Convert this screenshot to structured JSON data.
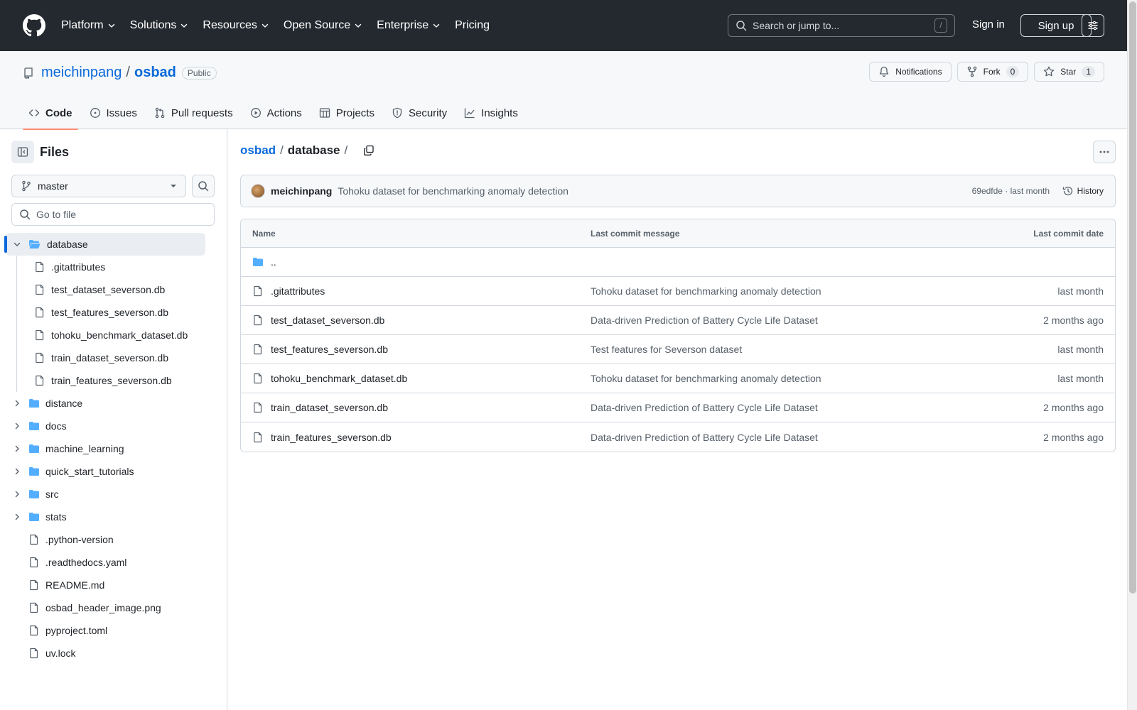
{
  "header": {
    "nav": [
      "Platform",
      "Solutions",
      "Resources",
      "Open Source",
      "Enterprise",
      "Pricing"
    ],
    "search_placeholder": "Search or jump to...",
    "search_shortcut": "/",
    "signin_label": "Sign in",
    "signup_label": "Sign up"
  },
  "repo": {
    "owner": "meichinpang",
    "separator": "/",
    "name": "osbad",
    "visibility": "Public",
    "notifications_label": "Notifications",
    "fork_label": "Fork",
    "fork_count": "0",
    "star_label": "Star",
    "star_count": "1",
    "tabs": [
      {
        "label": "Code",
        "icon": "code-icon"
      },
      {
        "label": "Issues",
        "icon": "issue-icon"
      },
      {
        "label": "Pull requests",
        "icon": "pull-request-icon"
      },
      {
        "label": "Actions",
        "icon": "play-icon"
      },
      {
        "label": "Projects",
        "icon": "table-icon"
      },
      {
        "label": "Security",
        "icon": "shield-icon"
      },
      {
        "label": "Insights",
        "icon": "graph-icon"
      }
    ]
  },
  "sidebar": {
    "title": "Files",
    "branch": "master",
    "goto_placeholder": "Go to file",
    "expanded_folder": "database",
    "expanded_children": [
      ".gitattributes",
      "test_dataset_severson.db",
      "test_features_severson.db",
      "tohoku_benchmark_dataset.db",
      "train_dataset_severson.db",
      "train_features_severson.db"
    ],
    "folders": [
      "distance",
      "docs",
      "machine_learning",
      "quick_start_tutorials",
      "src",
      "stats"
    ],
    "files": [
      ".python-version",
      ".readthedocs.yaml",
      "README.md",
      "osbad_header_image.png",
      "pyproject.toml",
      "uv.lock"
    ]
  },
  "main": {
    "breadcrumb_root": "osbad",
    "breadcrumb_current": "database",
    "breadcrumb_sep": "/",
    "commit": {
      "author": "meichinpang",
      "message": "Tohoku dataset for benchmarking anomaly detection",
      "meta": "69edfde · last month",
      "history_label": "History"
    },
    "table": {
      "headers": {
        "name": "Name",
        "message": "Last commit message",
        "date": "Last commit date"
      },
      "parent_link": "..",
      "rows": [
        {
          "name": ".gitattributes",
          "message": "Tohoku dataset for benchmarking anomaly detection",
          "date": "last month"
        },
        {
          "name": "test_dataset_severson.db",
          "message": "Data-driven Prediction of Battery Cycle Life Dataset",
          "date": "2 months ago"
        },
        {
          "name": "test_features_severson.db",
          "message": "Test features for Severson dataset",
          "date": "last month"
        },
        {
          "name": "tohoku_benchmark_dataset.db",
          "message": "Tohoku dataset for benchmarking anomaly detection",
          "date": "last month"
        },
        {
          "name": "train_dataset_severson.db",
          "message": "Data-driven Prediction of Battery Cycle Life Dataset",
          "date": "2 months ago"
        },
        {
          "name": "train_features_severson.db",
          "message": "Data-driven Prediction of Battery Cycle Life Dataset",
          "date": "2 months ago"
        }
      ]
    }
  },
  "colors": {
    "header_bg": "#24292f",
    "link": "#0969da",
    "folder": "#54aeff",
    "active_tab_underline": "#fd8c73"
  }
}
